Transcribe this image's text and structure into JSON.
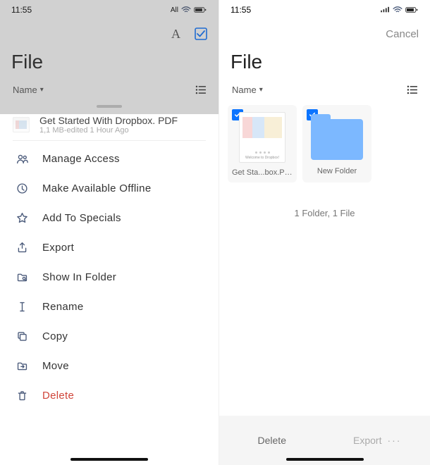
{
  "status": {
    "time": "11:55",
    "carrier": "All"
  },
  "left": {
    "title": "File",
    "sort_label": "Name",
    "file": {
      "name": "Get Started With Dropbox. PDF",
      "meta": "1,1 MB-edited 1 Hour Ago"
    },
    "menu": {
      "manage_access": "Manage Access",
      "available_offline": "Make Available Offline",
      "add_specials": "Add To Specials",
      "export": "Export",
      "show_in_folder": "Show In Folder",
      "rename": "Rename",
      "copy": "Copy",
      "move": "Move",
      "delete": "Delete"
    }
  },
  "right": {
    "cancel": "Cancel",
    "title": "File",
    "sort_label": "Name",
    "tiles": {
      "file_label": "Get Sta...box.PDF",
      "file_caption": "Welcome to Dropbox!",
      "folder_label": "New Folder"
    },
    "summary": "1 Folder, 1 File",
    "bottom": {
      "delete": "Delete",
      "export": "Export"
    }
  }
}
